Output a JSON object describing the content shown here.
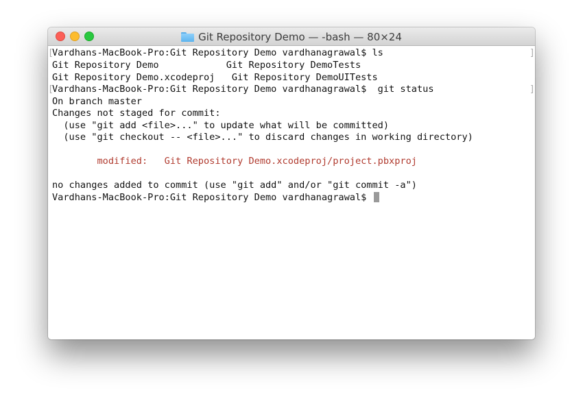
{
  "window": {
    "title": "Git Repository Demo — -bash — 80×24",
    "title_icon": "folder-icon",
    "buttons": [
      "close",
      "minimize",
      "zoom"
    ]
  },
  "terminal": {
    "lines": [
      "Vardhans-MacBook-Pro:Git Repository Demo vardhanagrawal$ ls",
      "Git Repository Demo            Git Repository DemoTests",
      "Git Repository Demo.xcodeproj   Git Repository DemoUITests",
      "Vardhans-MacBook-Pro:Git Repository Demo vardhanagrawal$  git status",
      "On branch master",
      "Changes not staged for commit:",
      "  (use \"git add <file>...\" to update what will be committed)",
      "  (use \"git checkout -- <file>...\" to discard changes in working directory)",
      "",
      "        modified:   Git Repository Demo.xcodeproj/project.pbxproj",
      "",
      "no changes added to commit (use \"git add\" and/or \"git commit -a\")",
      "Vardhans-MacBook-Pro:Git Repository Demo vardhanagrawal$ "
    ],
    "modified_color": "#b03a2e",
    "text_color": "#111111",
    "background": "#ffffff"
  }
}
